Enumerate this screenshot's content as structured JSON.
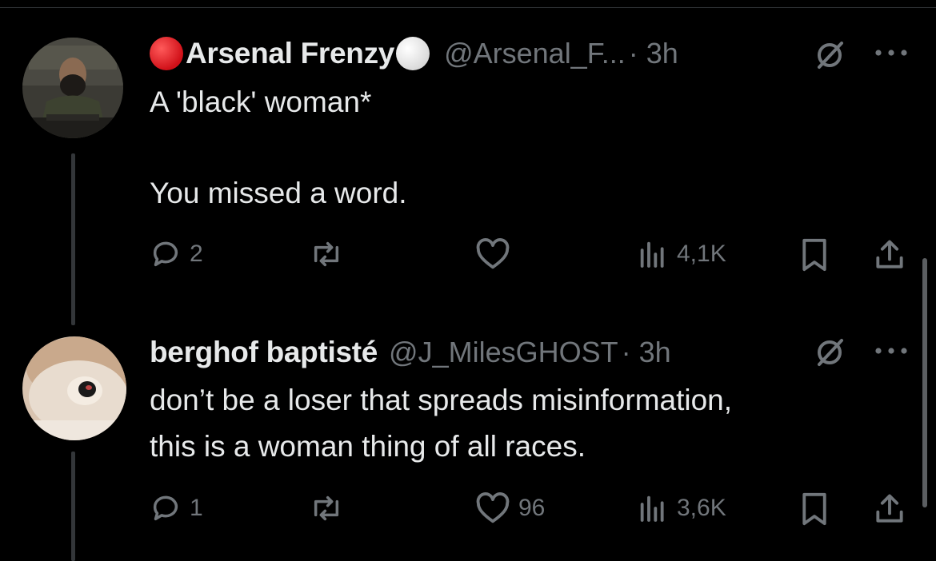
{
  "tweets": [
    {
      "display_name": "Arsenal Frenzy",
      "handle": "@Arsenal_F...",
      "time": "· 3h",
      "lines": [
        "A 'black' woman*",
        "",
        "You missed a word."
      ],
      "replies": "2",
      "reposts": "",
      "likes": "",
      "views": "4,1K"
    },
    {
      "display_name": "berghof baptisté",
      "handle": "@J_MilesGHOST",
      "time": "· 3h",
      "lines": [
        "don’t be a loser that spreads misinformation,",
        "this is a woman thing of all races."
      ],
      "replies": "1",
      "reposts": "",
      "likes": "96",
      "views": "3,6K"
    }
  ],
  "icons": [
    "reply-icon",
    "repost-icon",
    "like-icon",
    "views-icon",
    "bookmark-icon",
    "share-icon",
    "grok-icon",
    "more-icon"
  ],
  "colors": {
    "background": "#000000",
    "text": "#e7e9ea",
    "muted": "#71767b",
    "red_dot": "#e0202a"
  }
}
